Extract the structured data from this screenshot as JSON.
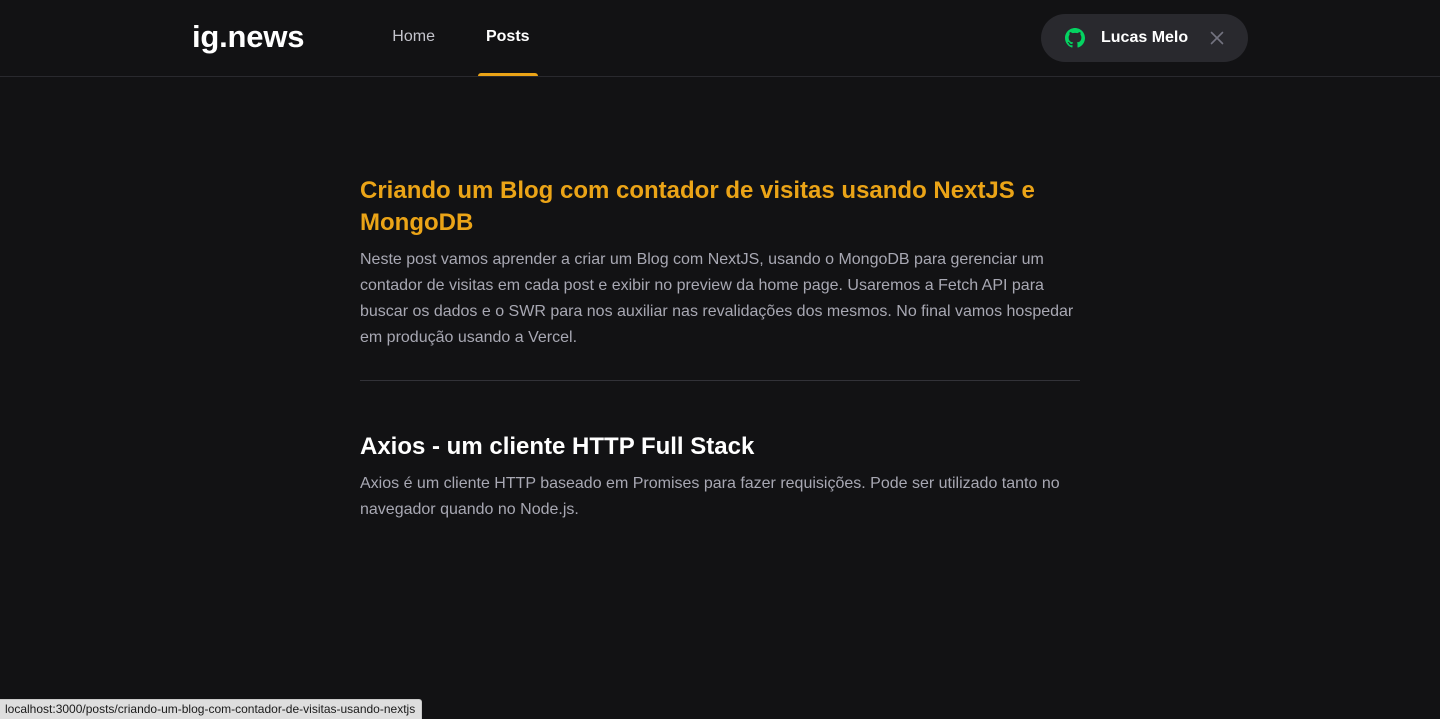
{
  "header": {
    "logo": "ig.news",
    "nav": [
      {
        "label": "Home",
        "active": false
      },
      {
        "label": "Posts",
        "active": true
      }
    ],
    "signin": {
      "icon": "github-icon",
      "user_name": "Lucas Melo",
      "close_icon": "close-icon",
      "github_color": "#04d361"
    }
  },
  "posts": [
    {
      "title": "Criando um Blog com contador de visitas usando NextJS e MongoDB",
      "excerpt": "Neste post vamos aprender a criar um Blog com NextJS, usando o MongoDB para gerenciar um contador de visitas em cada post e exibir no preview da home page. Usaremos a Fetch API para buscar os dados e o SWR para nos auxiliar nas revalidações dos mesmos. No final vamos hospedar em produção usando a Vercel."
    },
    {
      "title": "Axios - um cliente HTTP Full Stack",
      "excerpt": "Axios é um cliente HTTP baseado em Promises para fazer requisições. Pode ser utilizado tanto no navegador quando no Node.js."
    }
  ],
  "status_bar": {
    "url": "localhost:3000/posts/criando-um-blog-com-contador-de-visitas-usando-nextjs"
  },
  "colors": {
    "background": "#121214",
    "accent": "#eba417",
    "text": "#a8a8b3"
  }
}
